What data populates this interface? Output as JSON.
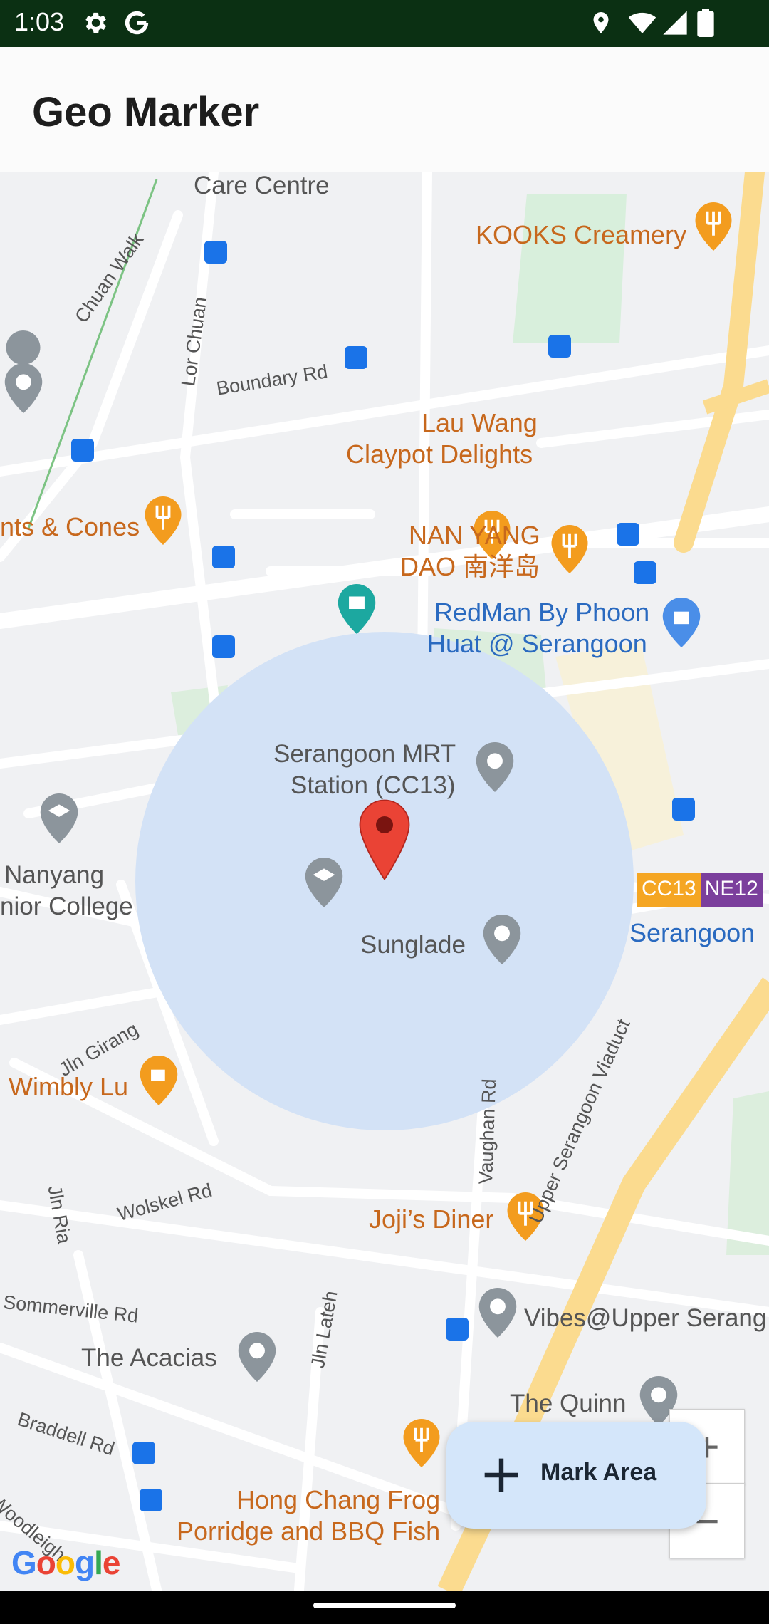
{
  "status_bar": {
    "time": "1:03",
    "icons": [
      "gear-icon",
      "google-g-icon",
      "location-icon",
      "wifi-icon",
      "signal-icon",
      "battery-icon"
    ]
  },
  "app_bar": {
    "title": "Geo Marker"
  },
  "map": {
    "labels": {
      "care_centre": "Care Centre",
      "kooks": "KOOKS Creamery",
      "chuan_walk": "Chuan Walk",
      "lor_chuan": "Lor Chuan",
      "boundary_rd": "Boundary Rd",
      "lau_wang_1": "Lau Wang",
      "lau_wang_2": "Claypot Delights",
      "cones": "nts & Cones",
      "nan_yang_1": "NAN YANG",
      "nan_yang_2": "DAO 南洋岛",
      "redman_1": "RedMan By Phoon",
      "redman_2": "Huat @ Serangoon",
      "mrt_1": "Serangoon MRT",
      "mrt_2": "Station (CC13)",
      "nanyang_1": "Nanyang",
      "nanyang_2": "nior College",
      "sunglade": "Sunglade",
      "serangoon": "Serangoon",
      "jln_girang": "Jln Girang",
      "wimbly": "Wimbly Lu",
      "vaughan": "Vaughan Rd",
      "upper_serangoon": "Upper Serangoon Viaduct",
      "jln_ria": "Jln Ria",
      "wolskel": "Wolskel Rd",
      "jojis": "Joji’s Diner",
      "sommerville": "Sommerville Rd",
      "jln_lateh": "Jln Lateh",
      "vibes": "Vibes@Upper Serang",
      "acacias": "The Acacias",
      "quinn": "The Quinn",
      "braddell": "Braddell Rd",
      "woodleigh": "Woodleigh",
      "hong_chang_1": "Hong Chang Frog",
      "hong_chang_2": "Porridge and BBQ Fish"
    },
    "mrt_codes": {
      "cc": "CC13",
      "ne": "NE12"
    },
    "colors": {
      "circle": "#d3e2f6",
      "marker": "#ea4335",
      "food": "#f39c1e",
      "place": "#8c959c",
      "transit": "#1a73e8",
      "cc_line": "#f5a623",
      "ne_line": "#7b3f9c"
    },
    "attribution": "Google"
  },
  "zoom": {
    "in": "+",
    "out": "−"
  },
  "fab": {
    "label": "Mark Area",
    "icon": "plus-icon"
  }
}
